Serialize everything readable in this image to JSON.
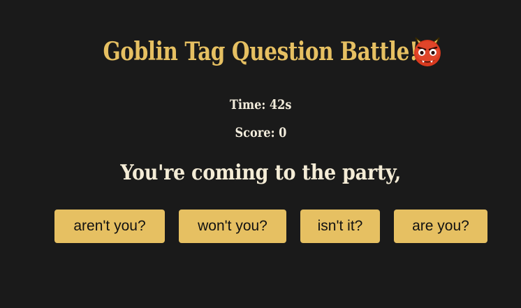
{
  "header": {
    "title": "Goblin Tag Question Battle!",
    "goblin_icon": "goblin-face-icon"
  },
  "stats": {
    "time": "Time: 42s",
    "score": "Score: 0"
  },
  "question": {
    "text": "You're coming to the party,"
  },
  "answers": [
    {
      "label": "aren't you?"
    },
    {
      "label": "won't you?"
    },
    {
      "label": "isn't it?"
    },
    {
      "label": "are you?"
    }
  ],
  "colors": {
    "background": "#1a1a1a",
    "accent": "#e6c062",
    "text": "#f4ecd6"
  }
}
